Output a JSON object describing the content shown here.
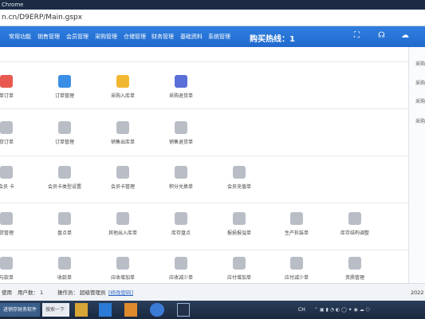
{
  "window": {
    "title": "Chrome"
  },
  "address": {
    "url": "n.cn/D9ERP/Main.gspx"
  },
  "nav": {
    "items": [
      "常用功能",
      "销售管理",
      "会员管理",
      "采购管理",
      "仓储管理",
      "财务管理",
      "基础资料",
      "系统管理"
    ],
    "hotline": "购买热线：1"
  },
  "rows": [
    [
      {
        "label": "单订单",
        "color": "#e85a4f"
      },
      {
        "label": "订单管理",
        "color": "#3a8ee6"
      },
      {
        "label": "采购入库单",
        "color": "#f2b731"
      },
      {
        "label": "采购退货单",
        "color": "#5b6fd8"
      }
    ],
    [
      {
        "label": "货订单"
      },
      {
        "label": "订单管理"
      },
      {
        "label": "销售出库单"
      },
      {
        "label": "销售退货单"
      }
    ],
    [
      {
        "label": "会员 卡"
      },
      {
        "label": "会员卡类型设置"
      },
      {
        "label": "会员卡管理"
      },
      {
        "label": "积分兑换单"
      },
      {
        "label": "会员充值单"
      }
    ],
    [
      {
        "label": "货管理"
      },
      {
        "label": "盘点单"
      },
      {
        "label": "其他出入库单"
      },
      {
        "label": "库存盘点"
      },
      {
        "label": "报损报溢单"
      },
      {
        "label": "生产拆装单"
      },
      {
        "label": "库存结构调整"
      }
    ],
    [
      {
        "label": "与款单"
      },
      {
        "label": "收款单"
      },
      {
        "label": "应收增加单"
      },
      {
        "label": "应收减少单"
      },
      {
        "label": "应付增加单"
      },
      {
        "label": "应付减少单"
      },
      {
        "label": "资质管理"
      }
    ]
  ],
  "right_panel": {
    "items": [
      "采购",
      "采购",
      "采购",
      "采购"
    ]
  },
  "status": {
    "left": "使用",
    "users_label": "用户数：",
    "users_value": "1",
    "operator_label": "操作员：",
    "operator_value": "超级管理员",
    "change_pw": "[修改密码]",
    "right": "2022"
  },
  "taskbar": {
    "app": "进销存财务软件",
    "search": "搜索一下",
    "lang": "CH"
  }
}
